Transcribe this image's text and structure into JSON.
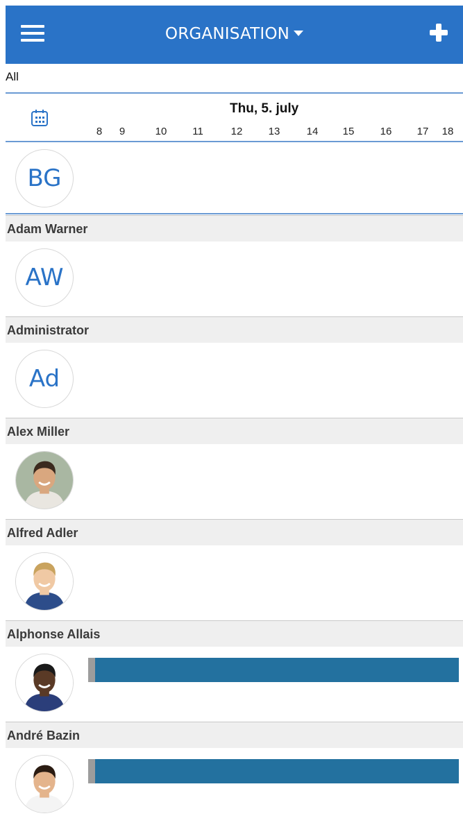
{
  "header": {
    "title": "ORGANISATION",
    "icons": {
      "menu": "hamburger-menu-icon",
      "dropdown": "caret-down-icon",
      "add": "plus-icon"
    }
  },
  "filter": {
    "label": "All"
  },
  "timeline": {
    "date": "Thu, 5. july",
    "hours": [
      "8",
      "9",
      "10",
      "11",
      "12",
      "13",
      "14",
      "15",
      "16",
      "17",
      "18"
    ],
    "calendar_icon": "calendar-icon"
  },
  "group": {
    "initials": "BG"
  },
  "people": [
    {
      "name": "Adam Warner",
      "initials": "AW",
      "photo": false,
      "bookings": []
    },
    {
      "name": "Administrator",
      "initials": "Ad",
      "photo": false,
      "bookings": []
    },
    {
      "name": "Alex Miller",
      "photo": true,
      "bookings": []
    },
    {
      "name": "Alfred Adler",
      "photo": true,
      "bookings": []
    },
    {
      "name": "Alphonse Allais",
      "photo": true,
      "bookings": [
        {
          "start": "8",
          "end": "18"
        }
      ]
    },
    {
      "name": "André Bazin",
      "photo": true,
      "bookings": [
        {
          "start": "8",
          "end": "18"
        }
      ]
    }
  ],
  "colors": {
    "header_bg": "#2a73c7",
    "accent": "#2a73c7",
    "booking_bar": "#23719f",
    "booking_lead": "#9c9c9c",
    "section_bg": "#efefef"
  }
}
